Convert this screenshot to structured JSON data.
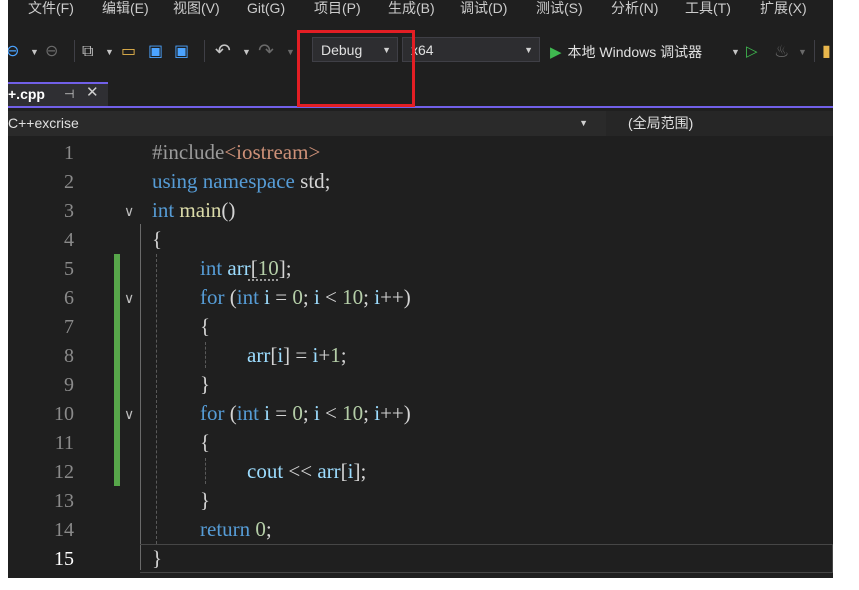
{
  "menu": [
    "文件(F)",
    "编辑(E)",
    "视图(V)",
    "Git(G)",
    "项目(P)",
    "生成(B)",
    "调试(D)",
    "测试(S)",
    "分析(N)",
    "工具(T)",
    "扩展(X)"
  ],
  "toolbar": {
    "configuration": "Debug",
    "platform": "x64",
    "run_label": "本地 Windows 调试器"
  },
  "tab": {
    "file_name": "+.cpp",
    "pin_glyph": "⊣",
    "close_glyph": "✕"
  },
  "navbar": {
    "project": "C++excrise",
    "scope": "(全局范围)"
  },
  "editor": {
    "current_line": 15,
    "lines": [
      {
        "n": "1"
      },
      {
        "n": "2"
      },
      {
        "n": "3"
      },
      {
        "n": "4"
      },
      {
        "n": "5"
      },
      {
        "n": "6"
      },
      {
        "n": "7"
      },
      {
        "n": "8"
      },
      {
        "n": "9"
      },
      {
        "n": "10"
      },
      {
        "n": "11"
      },
      {
        "n": "12"
      },
      {
        "n": "13"
      },
      {
        "n": "14"
      },
      {
        "n": "15"
      }
    ],
    "code": {
      "l1_pp": "#include",
      "l1_hdr": "<iostream>",
      "l2_kw1": "using",
      "l2_kw2": "namespace",
      "l2_ns": "std",
      "l2_semi": ";",
      "l3_kw": "int",
      "l3_fn": "main",
      "l3_paren": "()",
      "l4": "{",
      "l5_kw": "int",
      "l5_var": "arr",
      "l5_open": "[",
      "l5_num": "10",
      "l5_close": "];",
      "l6_kw": "for",
      "l6_a": " (",
      "l6_kw2": "int",
      "l6_var": " i",
      "l6_b": " = ",
      "l6_num1": "0",
      "l6_c": "; ",
      "l6_var2": "i",
      "l6_d": " < ",
      "l6_num2": "10",
      "l6_e": "; ",
      "l6_var3": "i",
      "l6_f": "++)",
      "l7": "{",
      "l8_var": "arr",
      "l8_a": "[",
      "l8_var2": "i",
      "l8_b": "] = ",
      "l8_var3": "i",
      "l8_c": "+",
      "l8_num": "1",
      "l8_d": ";",
      "l9": "}",
      "l10_kw": "for",
      "l10_a": " (",
      "l10_kw2": "int",
      "l10_var": " i",
      "l10_b": " = ",
      "l10_num1": "0",
      "l10_c": "; ",
      "l10_var2": "i",
      "l10_d": " < ",
      "l10_num2": "10",
      "l10_e": "; ",
      "l10_var3": "i",
      "l10_f": "++)",
      "l11": "{",
      "l12_var": "cout",
      "l12_a": " << ",
      "l12_var2": "arr",
      "l12_b": "[",
      "l12_var3": "i",
      "l12_c": "];",
      "l13": "}",
      "l14_kw": "return",
      "l14_num": " 0",
      "l14_semi": ";",
      "l15": "}"
    }
  },
  "colors": {
    "accent": "#7160e8",
    "highlight_box": "#e31e24",
    "change_bar": "#57a64a",
    "keyword": "#569cd6",
    "variable": "#9cdcfe",
    "string": "#ce9178",
    "number": "#b5cea8",
    "function": "#dcdcaa"
  }
}
